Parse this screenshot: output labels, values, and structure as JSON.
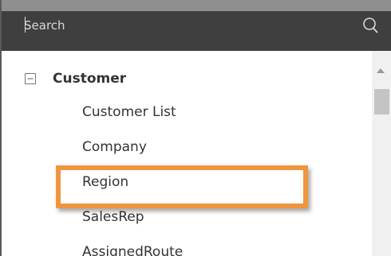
{
  "search": {
    "placeholder": "Search",
    "icon": "search-icon"
  },
  "tree": {
    "group": {
      "label": "Customer",
      "icon": "collapse-icon",
      "expanded": true
    },
    "items": [
      {
        "label": "Customer List"
      },
      {
        "label": "Company"
      },
      {
        "label": "Region",
        "highlighted": true
      },
      {
        "label": "SalesRep"
      },
      {
        "label": "AssignedRoute"
      }
    ]
  },
  "colors": {
    "search_bar": "#3f3f3f",
    "highlight": "#f0953e",
    "text": "#333333"
  }
}
